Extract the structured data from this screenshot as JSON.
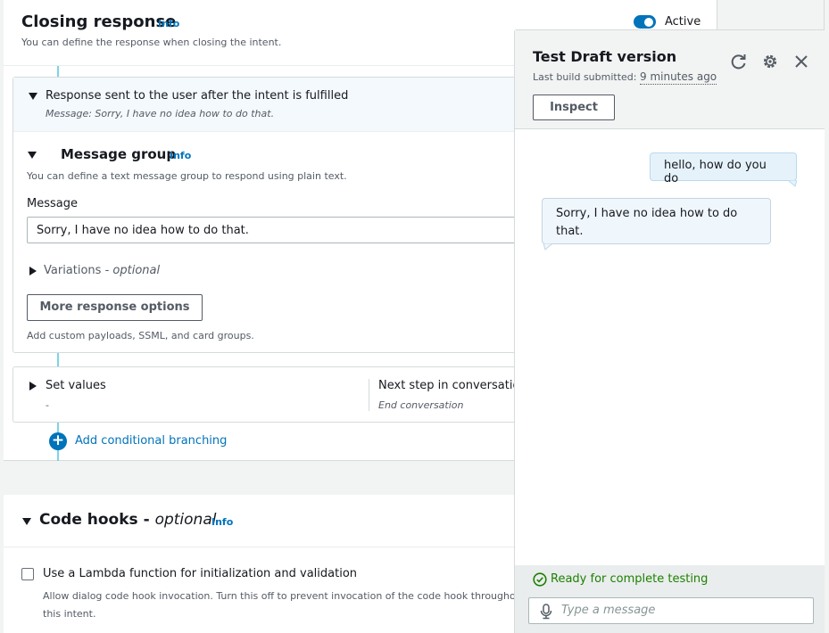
{
  "closing": {
    "title": "Closing response",
    "info": "Info",
    "description": "You can define the response when closing the intent.",
    "active_label": "Active"
  },
  "fulfilled": {
    "title": "Response sent to the user after the intent is fulfilled",
    "subtitle": "Message: Sorry, I have no idea how to do that."
  },
  "message_group": {
    "title": "Message group",
    "info": "Info",
    "description": "You can define a text message group to respond using plain text.",
    "message_label": "Message",
    "message_value": "Sorry, I have no idea how to do that.",
    "variations_label": "Variations - ",
    "variations_optional": "optional",
    "more_options_button": "More response options",
    "more_options_hint": "Add custom payloads, SSML, and card groups."
  },
  "set_values": {
    "label": "Set values",
    "value": "-",
    "next_step_label": "Next step in conversation",
    "next_step_value": "End conversation"
  },
  "add_branching": "Add conditional branching",
  "code_hooks": {
    "title": "Code hooks - ",
    "optional": "optional",
    "info": "Info",
    "lambda_label": "Use a Lambda function for initialization and validation",
    "lambda_desc_line1": "Allow dialog code hook invocation. Turn this off to prevent invocation of the code hook throughout",
    "lambda_desc_line2": "this intent."
  },
  "test_panel": {
    "title": "Test Draft version",
    "build_prefix": "Last build submitted: ",
    "build_time": "9 minutes ago",
    "inspect_button": "Inspect",
    "messages": [
      {
        "from": "user",
        "text": "hello, how do you do"
      },
      {
        "from": "bot",
        "text": "Sorry, I have no idea how to do that."
      }
    ],
    "status": "Ready for complete testing",
    "input_placeholder": "Type a message",
    "icons": [
      "refresh-icon",
      "settings-icon",
      "close-icon",
      "check-circle-icon",
      "microphone-icon"
    ]
  },
  "colors": {
    "accent": "#0073bb",
    "success": "#1d8102",
    "connector": "#7ed3e6"
  }
}
